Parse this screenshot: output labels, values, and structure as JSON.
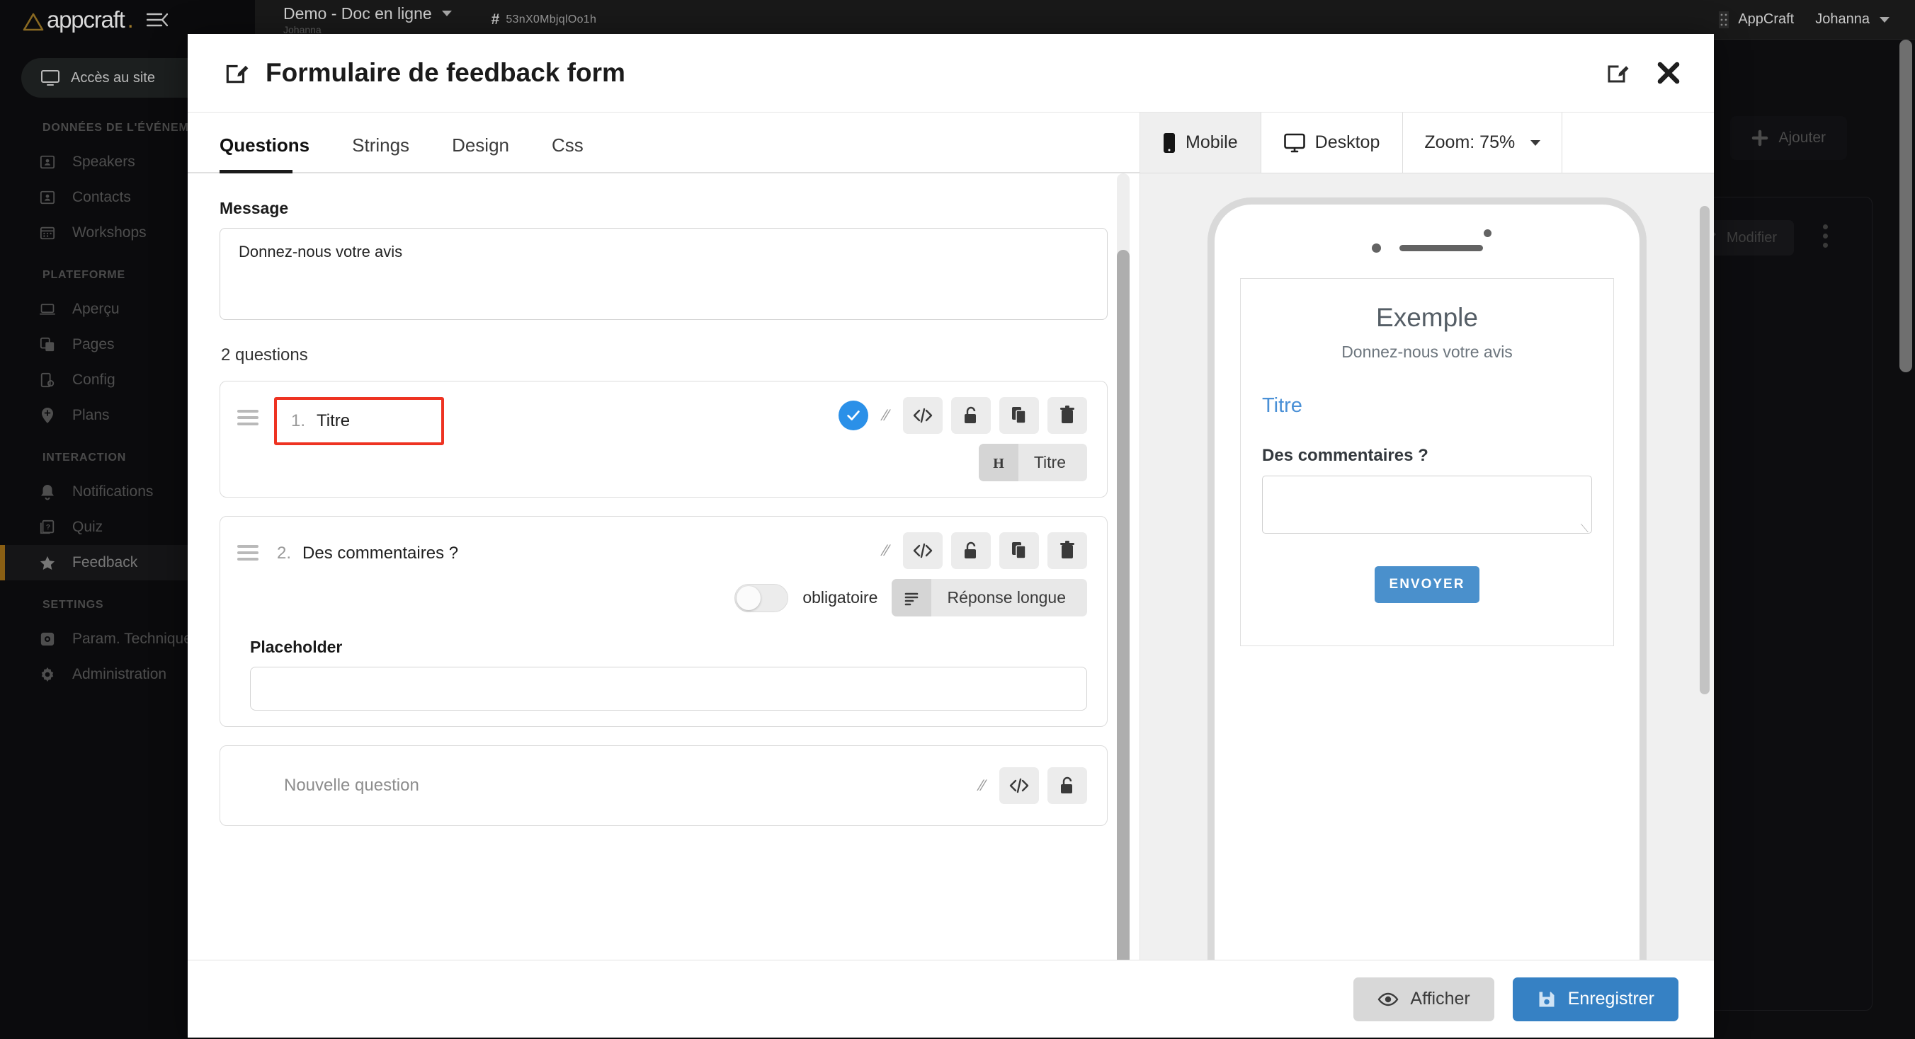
{
  "topbar": {
    "logo_text": "appcraft",
    "logo_dot": ".",
    "doc_title": "Demo - Doc en ligne",
    "doc_sub": "Johanna",
    "hash_symbol": "#",
    "hash_value": "53nX0MbjqlOo1h",
    "org_label": "AppCraft",
    "user_label": "Johanna"
  },
  "sidebar": {
    "access_label": "Accès au site",
    "groups": [
      {
        "title": "DONNÉES DE L'ÉVÉNEMENT",
        "items": [
          {
            "label": "Speakers",
            "icon": "contact-card-icon",
            "active": false
          },
          {
            "label": "Contacts",
            "icon": "contact-card-icon",
            "active": false
          },
          {
            "label": "Workshops",
            "icon": "calendar-icon",
            "active": false
          }
        ]
      },
      {
        "title": "PLATEFORME",
        "items": [
          {
            "label": "Aperçu",
            "icon": "laptop-icon",
            "active": false
          },
          {
            "label": "Pages",
            "icon": "copy-icon",
            "active": false
          },
          {
            "label": "Config",
            "icon": "config-icon",
            "active": false
          },
          {
            "label": "Plans",
            "icon": "map-pin-icon",
            "active": false
          }
        ]
      },
      {
        "title": "INTERACTION",
        "items": [
          {
            "label": "Notifications",
            "icon": "bell-icon",
            "active": false
          },
          {
            "label": "Quiz",
            "icon": "quiz-icon",
            "active": false
          },
          {
            "label": "Feedback",
            "icon": "star-icon",
            "active": true
          }
        ]
      },
      {
        "title": "SETTINGS",
        "items": [
          {
            "label": "Param. Techniques",
            "icon": "gear-square-icon",
            "active": false
          },
          {
            "label": "Administration",
            "icon": "gear-icon",
            "active": false
          }
        ]
      }
    ]
  },
  "background": {
    "add_label": "Ajouter",
    "modify_label": "Modifier"
  },
  "modal": {
    "title": "Formulaire de feedback form",
    "tabs": [
      {
        "label": "Questions",
        "active": true
      },
      {
        "label": "Strings",
        "active": false
      },
      {
        "label": "Design",
        "active": false
      },
      {
        "label": "Css",
        "active": false
      }
    ],
    "message_label": "Message",
    "message_value": "Donnez-nous votre avis",
    "question_count_label": "2 questions",
    "questions": [
      {
        "number": "1.",
        "text": "Titre",
        "highlighted": true,
        "checked": true,
        "type_label": "Titre",
        "type_icon": "heading-icon",
        "has_required_toggle": false,
        "required_label": "",
        "required_on": false,
        "placeholder_label": "",
        "placeholder_value": ""
      },
      {
        "number": "2.",
        "text": "Des commentaires ?",
        "highlighted": false,
        "checked": false,
        "type_label": "Réponse longue",
        "type_icon": "long-answer-icon",
        "has_required_toggle": true,
        "required_label": "obligatoire",
        "required_on": false,
        "placeholder_label": "Placeholder",
        "placeholder_value": ""
      }
    ],
    "new_question_label": "Nouvelle question",
    "footer": {
      "show_label": "Afficher",
      "save_label": "Enregistrer"
    }
  },
  "preview": {
    "toolbar": {
      "mobile_label": "Mobile",
      "desktop_label": "Desktop",
      "zoom_label": "Zoom: 75%"
    },
    "form": {
      "heading": "Exemple",
      "subtitle": "Donnez-nous votre avis",
      "field_title": "Titre",
      "field_question": "Des commentaires ?",
      "submit_label": "ENVOYER"
    }
  },
  "colors": {
    "accent_blue": "#3681c4",
    "preview_blue": "#4a90cc",
    "highlight_red": "#ee3322",
    "check_blue": "#2b90e8",
    "sidebar_active": "#8a5f14"
  }
}
